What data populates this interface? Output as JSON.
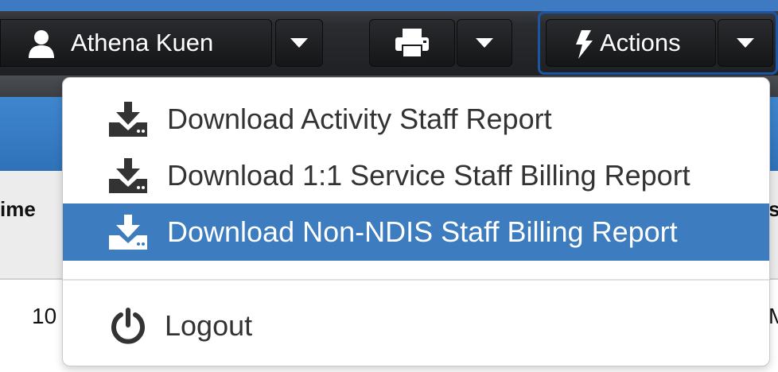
{
  "navbar": {
    "user_name": "Athena Kuen",
    "actions_label": "Actions"
  },
  "table": {
    "left_header_fragment": "ime",
    "right_header_fragment": "si",
    "left_cell_fragment": "10",
    "right_cell_fragment": "M"
  },
  "actions_menu": {
    "items": [
      {
        "label": "Download Activity Staff Report",
        "icon": "download-icon",
        "active": false
      },
      {
        "label": "Download 1:1 Service Staff Billing Report",
        "icon": "download-icon",
        "active": false
      },
      {
        "label": "Download Non-NDIS Staff Billing Report",
        "icon": "download-icon",
        "active": true
      }
    ],
    "logout": {
      "label": "Logout",
      "icon": "power-icon"
    }
  },
  "colors": {
    "nav_accent": "#3d7ac2",
    "active_item_bg": "#3c7cbf",
    "focus_ring": "#1a56a6",
    "button_bg": "#1d1e20"
  }
}
